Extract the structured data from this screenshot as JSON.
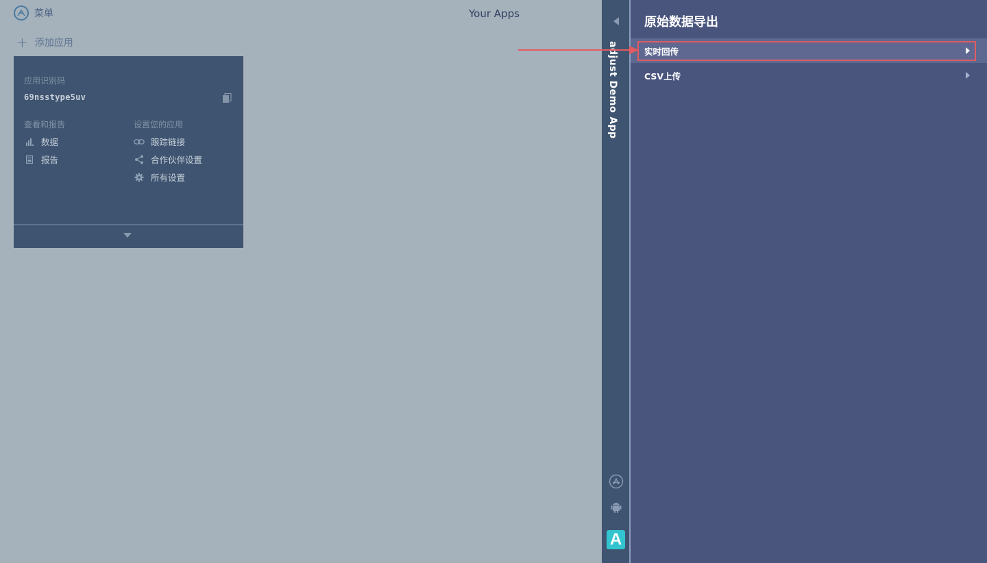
{
  "header": {
    "menu_label": "菜单",
    "page_title": "Your Apps",
    "add_app_label": "添加应用"
  },
  "app_card": {
    "token_label": "应用识别码",
    "token_value": "69nsstype5uv",
    "reports_section_label": "查看和报告",
    "reports_links": [
      {
        "label": "数据",
        "icon": "bar-chart-icon"
      },
      {
        "label": "报告",
        "icon": "document-icon"
      }
    ],
    "settings_section_label": "设置您的应用",
    "settings_links": [
      {
        "label": "跟踪链接",
        "icon": "link-icon"
      },
      {
        "label": "合作伙伴设置",
        "icon": "share-icon"
      },
      {
        "label": "所有设置",
        "icon": "gear-icon"
      }
    ]
  },
  "app_strip": {
    "app_name": "adjust Demo App",
    "platforms": [
      "app-store-icon",
      "android-icon"
    ],
    "brand_logo": "A"
  },
  "right_panel": {
    "title": "原始数据导出",
    "items": [
      {
        "label": "实时回传",
        "active": true
      },
      {
        "label": "CSV上传",
        "active": false
      }
    ]
  },
  "colors": {
    "background": "#a5b1bb",
    "card": "#3f5470",
    "panel": "#4a557e",
    "highlight": "#e25b62",
    "brand": "#33c5cf"
  }
}
